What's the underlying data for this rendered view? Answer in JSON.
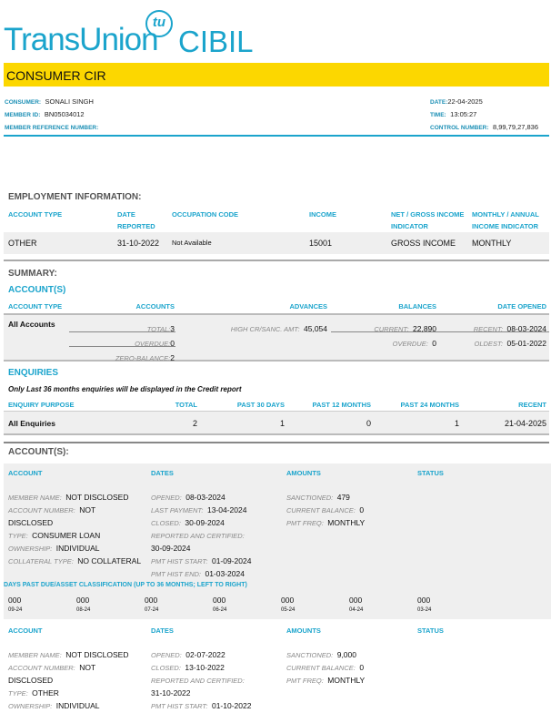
{
  "logo": {
    "brand": "TransUnion",
    "mark": "tu",
    "product": "CIBIL"
  },
  "banner": {
    "title": "CONSUMER CIR"
  },
  "header": {
    "consumer_label": "CONSUMER:",
    "consumer": "SONALI SINGH",
    "member_id_label": "MEMBER ID:",
    "member_id": "BN05034012",
    "member_ref_label": "MEMBER REFERENCE NUMBER:",
    "date_label": "DATE:",
    "date": "22-04-2025",
    "time_label": "TIME:",
    "time": "13:05:27",
    "control_label": "CONTROL NUMBER:",
    "control": "8,99,79,27,836"
  },
  "employment": {
    "title": "EMPLOYMENT INFORMATION:",
    "headers": [
      "ACCOUNT TYPE",
      "DATE REPORTED",
      "OCCUPATION CODE",
      "INCOME",
      "NET / GROSS INCOME INDICATOR",
      "MONTHLY / ANNUAL INCOME INDICATOR"
    ],
    "row": [
      "OTHER",
      "31-10-2022",
      "Not Available",
      "15001",
      "GROSS INCOME",
      "MONTHLY"
    ]
  },
  "summary": {
    "title": "SUMMARY:",
    "accounts_title": "ACCOUNT(S)",
    "headers": [
      "ACCOUNT TYPE",
      "ACCOUNTS",
      "ADVANCES",
      "BALANCES",
      "DATE OPENED"
    ],
    "row_label": "All Accounts",
    "total_label": "TOTAL:",
    "total": "3",
    "overdue_label": "OVERDUE:",
    "overdue": "0",
    "zero_label": "ZERO-BALANCE:",
    "zero": "2",
    "high_label": "HIGH CR/SANC. AMT:",
    "high": "45,054",
    "current_label": "CURRENT:",
    "current": "22,890",
    "bal_overdue_label": "OVERDUE:",
    "bal_overdue": "0",
    "recent_label": "RECENT:",
    "recent": "08-03-2024",
    "oldest_label": "OLDEST:",
    "oldest": "05-01-2022"
  },
  "enquiries": {
    "title": "ENQUIRIES",
    "note": "Only Last 36 months enquiries will be displayed in the Credit report",
    "headers": [
      "ENQUIRY PURPOSE",
      "TOTAL",
      "PAST 30 DAYS",
      "PAST 12 MONTHS",
      "PAST 24 MONTHS",
      "RECENT"
    ],
    "row": [
      "All Enquiries",
      "2",
      "1",
      "0",
      "1",
      "21-04-2025"
    ]
  },
  "accounts": {
    "title": "ACCOUNT(S):",
    "headers": [
      "ACCOUNT",
      "DATES",
      "AMOUNTS",
      "STATUS"
    ],
    "dpd_title": "DAYS PAST DUE/ASSET CLASSIFICATION (UP TO 36 MONTHS; LEFT TO RIGHT)",
    "list": [
      {
        "account": [
          [
            "MEMBER NAME:",
            "NOT DISCLOSED"
          ],
          [
            "ACCOUNT NUMBER:",
            "NOT"
          ],
          [
            "",
            "DISCLOSED"
          ],
          [
            "TYPE:",
            "CONSUMER LOAN"
          ],
          [
            "OWNERSHIP:",
            "INDIVIDUAL"
          ],
          [
            "COLLATERAL TYPE:",
            "NO COLLATERAL"
          ]
        ],
        "dates": [
          [
            "OPENED:",
            "08-03-2024"
          ],
          [
            "LAST PAYMENT:",
            "13-04-2024"
          ],
          [
            "CLOSED:",
            "30-09-2024"
          ],
          [
            "REPORTED AND CERTIFIED:",
            ""
          ],
          [
            "",
            "30-09-2024"
          ],
          [
            "PMT HIST START:",
            "01-09-2024"
          ],
          [
            "PMT HIST END:",
            "01-03-2024"
          ]
        ],
        "amounts": [
          [
            "SANCTIONED:",
            "479"
          ],
          [
            "CURRENT BALANCE:",
            "0"
          ],
          [
            "PMT FREQ:",
            "MONTHLY"
          ]
        ],
        "dpd": [
          [
            "000",
            "09-24"
          ],
          [
            "000",
            "08-24"
          ],
          [
            "000",
            "07-24"
          ],
          [
            "000",
            "06-24"
          ],
          [
            "000",
            "05-24"
          ],
          [
            "000",
            "04-24"
          ],
          [
            "000",
            "03-24"
          ]
        ]
      },
      {
        "account": [
          [
            "MEMBER NAME:",
            "NOT DISCLOSED"
          ],
          [
            "ACCOUNT NUMBER:",
            "NOT"
          ],
          [
            "",
            "DISCLOSED"
          ],
          [
            "TYPE:",
            "OTHER"
          ],
          [
            "OWNERSHIP:",
            "INDIVIDUAL"
          ]
        ],
        "dates": [
          [
            "OPENED:",
            "02-07-2022"
          ],
          [
            "CLOSED:",
            "13-10-2022"
          ],
          [
            "REPORTED AND CERTIFIED:",
            ""
          ],
          [
            "",
            "31-10-2022"
          ],
          [
            "PMT HIST START:",
            "01-10-2022"
          ]
        ],
        "amounts": [
          [
            "SANCTIONED:",
            "9,000"
          ],
          [
            "CURRENT BALANCE:",
            "0"
          ],
          [
            "PMT FREQ:",
            "MONTHLY"
          ]
        ]
      }
    ]
  },
  "colors": {
    "teal": "#1ba4cc",
    "yellow": "#fcd700",
    "panel": "#efefef"
  }
}
